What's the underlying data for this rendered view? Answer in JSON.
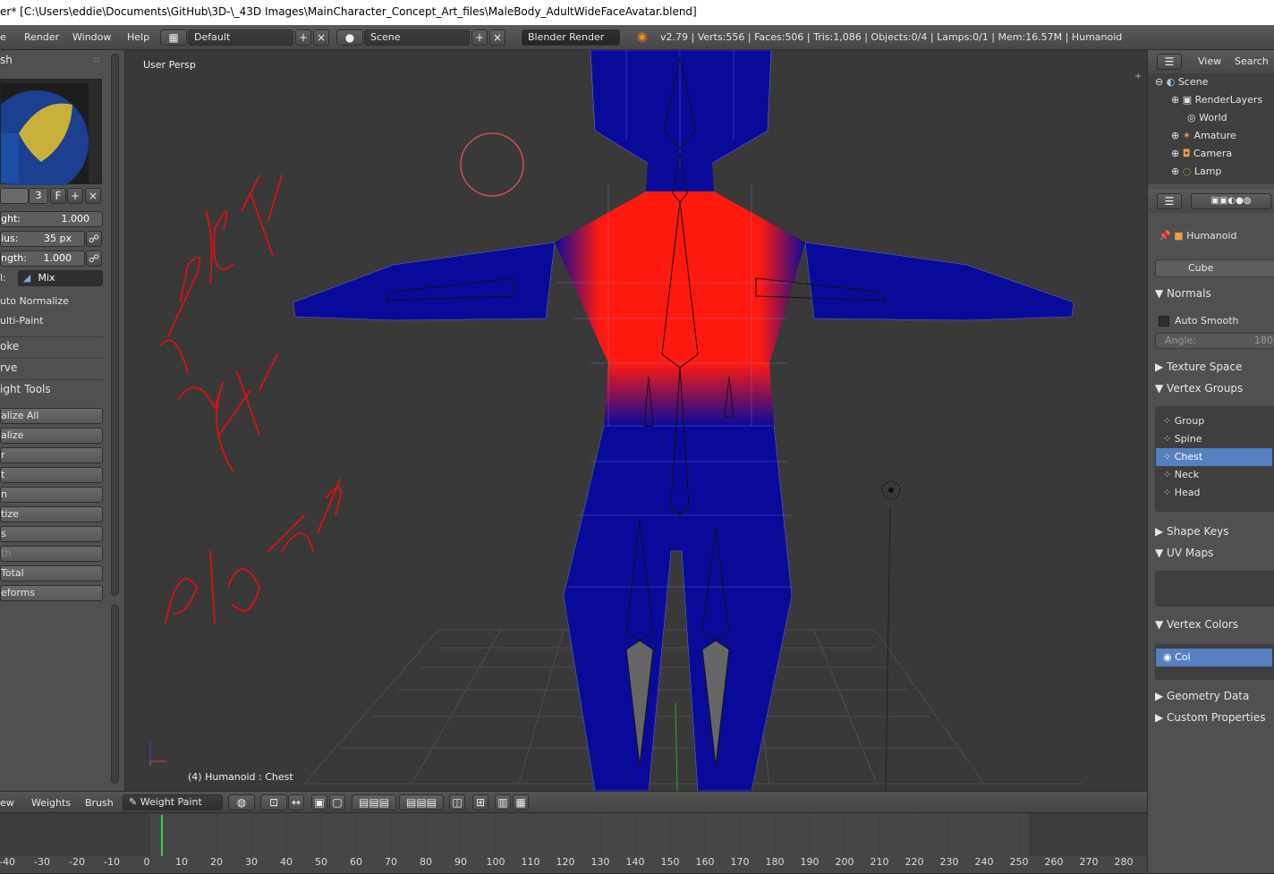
{
  "title": {
    "text": "er* [C:\\Users\\eddie\\Documents\\GitHub\\3D-\\_43D Images\\MainCharacter_Concept_Art_files\\MaleBody_AdultWideFaceAvatar.blend]"
  },
  "menubar": {
    "items": [
      "e",
      "Render",
      "Window",
      "Help"
    ],
    "layout_value": "Default",
    "scene_value": "Scene",
    "engine_value": "Blender Render",
    "stats": "v2.79 | Verts:556 | Faces:506 | Tris:1,086 | Objects:0/4 | Lamps:0/1 | Mem:16.57M | Humanoid"
  },
  "toolshelf": {
    "brush_header": "sh",
    "users_count": "3",
    "fake_user": "F",
    "weight_label": "ght:",
    "weight_value": "1.000",
    "radius_label": "ius:",
    "radius_value": "35 px",
    "strength_label": "ngth:",
    "strength_value": "1.000",
    "blend_label": "l:",
    "blend_value": "Mix",
    "auto_normalize": "uto Normalize",
    "multi_paint": "ulti-Paint",
    "stroke_header": "oke",
    "curve_header": "rve",
    "weight_tools_header": "ight Tools",
    "buttons": [
      "alize All",
      "alize",
      "r",
      "t",
      "n",
      "tize",
      "s",
      "th",
      " Total",
      "eforms"
    ]
  },
  "viewport": {
    "view_label": "User Persp",
    "object_label": "(4) Humanoid : Chest",
    "annotations": [
      "weight paint",
      "6/18/2019"
    ]
  },
  "viewport_header": {
    "menus": [
      "ew",
      "Weights",
      "Brush"
    ],
    "mode_value": "Weight Paint"
  },
  "timeline": {
    "ticks": [
      "-40",
      "-30",
      "-20",
      "-10",
      "0",
      "10",
      "20",
      "30",
      "40",
      "50",
      "60",
      "70",
      "80",
      "90",
      "100",
      "110",
      "120",
      "130",
      "140",
      "150",
      "160",
      "170",
      "180",
      "190",
      "200",
      "210",
      "220",
      "230",
      "240",
      "250",
      "260",
      "270",
      "280"
    ],
    "current_frame": 4
  },
  "outliner": {
    "view_label": "View",
    "search_label": "Search",
    "items": [
      {
        "label": "Scene",
        "icon": "scene-icon"
      },
      {
        "label": "RenderLayers",
        "icon": "renderlayers-icon"
      },
      {
        "label": "World",
        "icon": "world-icon"
      },
      {
        "label": "Amature",
        "icon": "armature-icon"
      },
      {
        "label": "Camera",
        "icon": "camera-icon"
      },
      {
        "label": "Lamp",
        "icon": "lamp-icon"
      }
    ]
  },
  "properties": {
    "breadcrumb_object": "Humanoid",
    "mesh_name": "Cube",
    "normals_header": "Normals",
    "auto_smooth": "Auto Smooth",
    "angle_label": "Angle:",
    "angle_value": "180°",
    "texture_space": "Texture Space",
    "vertex_groups_header": "Vertex Groups",
    "vertex_groups": [
      "Group",
      "Spine",
      "Chest",
      "Neck",
      "Head"
    ],
    "selected_group": "Chest",
    "shape_keys": "Shape Keys",
    "uv_maps": "UV Maps",
    "vertex_colors_header": "Vertex Colors",
    "vertex_color_item": "Col",
    "geometry_data": "Geometry Data",
    "custom_properties": "Custom Properties"
  },
  "colors": {
    "accent": "#5680c2",
    "weight_hot": "#ff1a10",
    "weight_cold": "#0a0a9a",
    "annotation": "#e01010"
  }
}
